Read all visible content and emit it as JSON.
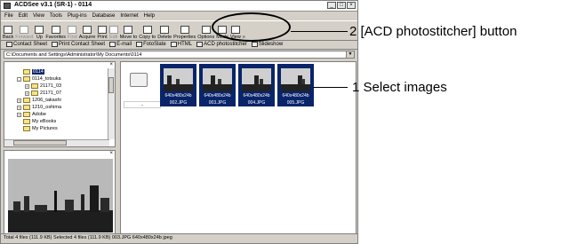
{
  "window": {
    "title": "ACDSee v3.1 (SR-1) - 0114",
    "controls": [
      "_",
      "□",
      "×"
    ]
  },
  "menu": [
    "File",
    "Edit",
    "View",
    "Tools",
    "Plug-ins",
    "Database",
    "Internet",
    "Help"
  ],
  "toolbar": [
    {
      "label": "Back",
      "enabled": true
    },
    {
      "label": "Forward",
      "enabled": false
    },
    {
      "label": "Up",
      "enabled": true
    },
    {
      "label": "Favorites",
      "enabled": true
    },
    {
      "label": "Find",
      "enabled": false
    },
    {
      "label": "Acquire",
      "enabled": true
    },
    {
      "label": "Print",
      "enabled": true
    },
    {
      "label": "Edit",
      "enabled": false
    },
    {
      "label": "Move to",
      "enabled": true
    },
    {
      "label": "Copy to",
      "enabled": true
    },
    {
      "label": "Delete",
      "enabled": true
    },
    {
      "label": "Properties",
      "enabled": true
    },
    {
      "label": "Options",
      "enabled": true
    },
    {
      "label": "Mode",
      "enabled": true
    },
    {
      "label": "View",
      "enabled": true
    },
    {
      "label": "»",
      "enabled": true
    }
  ],
  "links": [
    "Contact Sheet",
    "Print Contact Sheet",
    "E-mail",
    "FotoSlate",
    "HTML",
    "ACD photostitcher",
    "Slideshow"
  ],
  "address": "C:\\Documents and Settings\\Administrator\\My Documents\\0114",
  "tree": [
    {
      "label": "0114",
      "selected": true,
      "expander": "",
      "indent": 0
    },
    {
      "label": "0114_totsuka",
      "selected": false,
      "expander": "-",
      "indent": 0
    },
    {
      "label": "21171_03",
      "selected": false,
      "expander": "+",
      "indent": 1
    },
    {
      "label": "21171_07",
      "selected": false,
      "expander": "+",
      "indent": 1
    },
    {
      "label": "1206_takashi",
      "selected": false,
      "expander": "+",
      "indent": 0
    },
    {
      "label": "1210_oshima",
      "selected": false,
      "expander": "+",
      "indent": 0
    },
    {
      "label": "Adobe",
      "selected": false,
      "expander": "+",
      "indent": 0
    },
    {
      "label": "My eBooks",
      "selected": false,
      "expander": "",
      "indent": 0
    },
    {
      "label": "My Pictures",
      "selected": false,
      "expander": "",
      "indent": 0
    }
  ],
  "files": {
    "up_label": "..",
    "thumbnails": [
      {
        "name": "002.JPG",
        "res": "640x480x24b"
      },
      {
        "name": "003.JPG",
        "res": "640x480x24b"
      },
      {
        "name": "004.JPG",
        "res": "640x480x24b"
      },
      {
        "name": "005.JPG",
        "res": "640x480x24b"
      }
    ]
  },
  "status": "Total 4 files (111.9 KB)   Selected 4 files (111.9 KB)   003.JPG   640x480x24b jpeg",
  "annotations": {
    "callout_button": "2 [ACD photostitcher] button",
    "callout_select": "1 Select images"
  }
}
